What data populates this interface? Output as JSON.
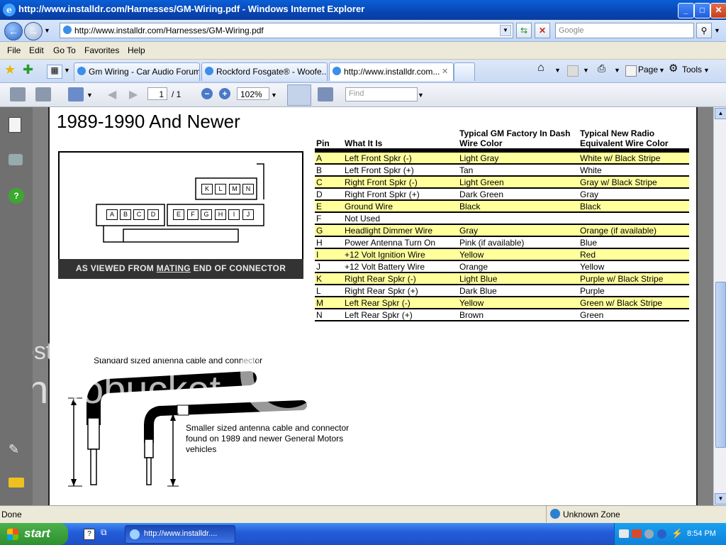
{
  "window": {
    "title": "http://www.installdr.com/Harnesses/GM-Wiring.pdf - Windows Internet Explorer",
    "minimize": "_",
    "maximize": "□",
    "close": "✕"
  },
  "address_bar": {
    "url": "http://www.installdr.com/Harnesses/GM-Wiring.pdf",
    "search_placeholder": "Google"
  },
  "menu": [
    "File",
    "Edit",
    "Go To",
    "Favorites",
    "Help"
  ],
  "tabs": [
    {
      "label": "Gm Wiring - Car Audio Forum..."
    },
    {
      "label": "Rockford Fosgate® - Woofe..."
    },
    {
      "label": "http://www.installdr.com...",
      "active": true
    }
  ],
  "command_bar": {
    "page": "Page",
    "tools": "Tools"
  },
  "pdf_toolbar": {
    "page_current": "1",
    "page_sep": "/ 1",
    "zoom": "102%",
    "find_placeholder": "Find"
  },
  "document": {
    "heading": "1989-1990 And Newer",
    "table": {
      "headers": [
        "Pin",
        "What It Is",
        "Typical GM Factory In Dash Wire Color",
        "Typical New Radio Equivalent Wire Color"
      ],
      "rows": [
        [
          "A",
          "Left Front Spkr (-)",
          "Light Gray",
          "White w/ Black Stripe"
        ],
        [
          "B",
          "Left Front Spkr (+)",
          "Tan",
          "White"
        ],
        [
          "C",
          "Right Front Spkr (-)",
          "Light Green",
          "Gray w/ Black Stripe"
        ],
        [
          "D",
          "Right Front Spkr (+)",
          "Dark Green",
          "Gray"
        ],
        [
          "E",
          "Ground Wire",
          "Black",
          "Black"
        ],
        [
          "F",
          "Not Used",
          "",
          ""
        ],
        [
          "G",
          "Headlight Dimmer Wire",
          "Gray",
          "Orange (if available)"
        ],
        [
          "H",
          "Power Antenna Turn On",
          "Pink (if available)",
          "Blue"
        ],
        [
          "I",
          "+12 Volt Ignition Wire",
          "Yellow",
          "Red"
        ],
        [
          "J",
          "+12 Volt Battery Wire",
          "Orange",
          "Yellow"
        ],
        [
          "K",
          "Right Rear Spkr (-)",
          "Light Blue",
          "Purple w/ Black Stripe"
        ],
        [
          "L",
          "Right Rear Spkr (+)",
          "Dark Blue",
          "Purple"
        ],
        [
          "M",
          "Left Rear Spkr (-)",
          "Yellow",
          "Green w/ Black Stripe"
        ],
        [
          "N",
          "Left Rear Spkr (+)",
          "Brown",
          "Green"
        ]
      ]
    },
    "connector": {
      "top_pins": [
        "K",
        "L",
        "M",
        "N"
      ],
      "left_pins": [
        "A",
        "B",
        "C",
        "D"
      ],
      "right_pins": [
        "E",
        "F",
        "G",
        "H",
        "I",
        "J"
      ],
      "label_prefix": "AS VIEWED FROM ",
      "label_emph": "MATING",
      "label_suffix": " END OF CONNECTOR"
    },
    "antenna": {
      "standard_caption": "Standard sized antenna cable and connector",
      "smaller_caption_1": "Smaller sized antenna cable and connector",
      "smaller_caption_2": "found on 1989 and newer General Motors",
      "smaller_caption_3": "vehicles"
    },
    "watermark": {
      "line1": "host. store. share.",
      "line2": "photobucket"
    }
  },
  "status_bar": {
    "left": "Done",
    "zone": "Unknown Zone"
  },
  "taskbar": {
    "start": "start",
    "task_item": "http://www.installdr....",
    "clock": "8:54 PM"
  }
}
